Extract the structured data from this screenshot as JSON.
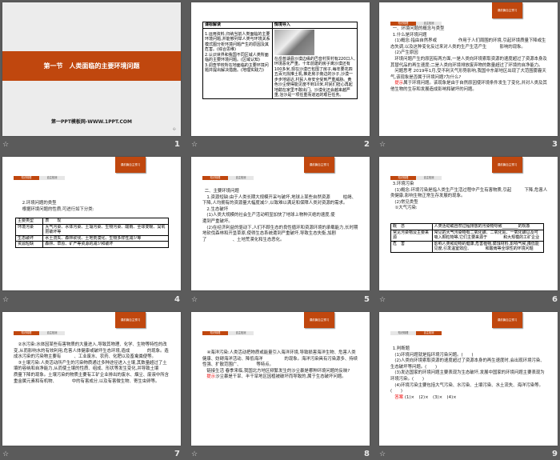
{
  "common": {
    "header_badge": "课前篇自主预习",
    "tab1": "知识梳理",
    "tab2": "自主检测",
    "star_icon": "☆"
  },
  "slides": [
    {
      "number": "1",
      "title": "第一节　人类面临的主要环境问题",
      "footer": "第一PPT模板网-WWW.1PPT.COM"
    },
    {
      "number": "2",
      "table_headers": [
        "课标解读",
        "情境导入"
      ],
      "left": [
        "1.运用资料,归纳当前人类面临的主要环境问题,并能够列举人类与环境关系模式图分析环境问题产生的原因及其危害。(综合思维)",
        "2.认识世界和我国不同区域人类所面临的主要环境问题。(区域认知)",
        "3.调查学校所在地面临的主要环境问题并提出解决措施。(地理实践力)"
      ],
      "right": "在岳普湖县沙漠边缘的巴音村贾村有220口人,环境恶化严重。十年前建的房子离沙漠还有100多米,现在沙漠已包围了房子,每年要花四五百元找推土机,推走房子旁边的沙子,沙漠一步步地逼近,村民人身安全受到严重威胁。黄色沙尘使得能见度不到10米,村民们担心再起地鹬在家里不敢出门。沙漠化还会越来越严重,治沙是一项任重而道远的艰巨任务。"
    },
    {
      "number": "3",
      "lines": [
        "一、环境问题的概念与类型",
        "1.什么是环境问题",
        "(1)概念:指由自然界或　　　　　作用于人们周围的环境,引起环境质量下降或生态失调,以及这种变化反过来对人类的生产生活产生　　　影响的现象。",
        "(2)产生原因",
        "环境问题产生的原因有两方面,一是人类向环境索取资源的速度超过了资源本身及其替代品的再生速度;二是人类向环境排放废弃物的数量超过了环境的自净能力。",
        "问题思考 2019年1月,受不利天气形势影响,我国中东部地区出现了大范围雾霾天气,该现象是否属于环境问题?为什么?"
      ],
      "hint_label": "提示",
      "hint": "属于环境问题。该现象是由于自然原因使环境条件发生了变化,并对人类及其他生物的生存和发展造成影响和破坏的问题。"
    },
    {
      "number": "4",
      "lines": [
        "2.环境问题的类型",
        "根据环境问题的性质,可进行如下分类:"
      ],
      "table": [
        [
          "主要类型",
          "表　　现"
        ],
        [
          "环境污染",
          "大气污染、水体污染、土壤污染、生物污染、酸雨、全球变暖、臭氧层破坏等"
        ],
        [
          "生态破坏",
          "水土流失、森林砍伐、土地荒漠化、生物多样性减少等"
        ],
        [
          "资源短缺",
          "森林、草原、矿产等资源的减少和破坏"
        ]
      ]
    },
    {
      "number": "5",
      "lines": [
        "二、主要环境问题",
        "1.资源短缺:由于人类长期大规模开采与破坏,地球上某些自然资源　　　枯竭、　　　下降,人均拥有的资源量大幅度减少,以致难以满足和保障人类对资源的需求。",
        "2.生态破坏",
        "(1)人类大规模的社会生产活动明显加快了地球上物种灭绝的速度,使　　　　　　遭到严重破坏。",
        "(2)在经济利益的驱动下,人们不顾生态的良性循环和资源环境的承载能力,长时期地砍伐森林和开垦草原,使得生态系统遭到严重破坏,导致生态失衡,加剧了　　　　　　、土地荒漠化和生态恶化。"
      ]
    },
    {
      "number": "6",
      "lines": [
        "3.环境污染",
        "(1)概念:环境污染是指人类生产生活过程中产生有害物质,引起　　　下降,危害人类健康,影响生物正常生存发展的现象。",
        "(2)常见类型",
        "①大气污染:"
      ],
      "table": [
        [
          "概　念",
          "人类活动或自然过程排放的污染物导致________的现象"
        ],
        [
          "常见污染物及主要来源",
          "常见的大气污染物有二氧化碳、二氧化氮、一氧化碳以及可吸入颗粒物等,它们主要来源于　　　　和大规模的工矿企业"
        ],
        [
          "危　害",
          "影响人类和动物的健康,危害植物,腐蚀材料,影响气候,降低能见度,引发温室效应、　　　　和酸雨等全球性的环境问题"
        ]
      ]
    },
    {
      "number": "7",
      "lines": [
        "②水污染:水体因某些有害物质的大量进入,导致其物理、化学、生物等特性的改变,从而影响水的有效利用,危害人体健康或破坏生态环境,造成　　　　的现象。造成水污染的污染物主要有　　　、工业废水、农药、化肥以及畜禽粪便等。",
        "③土壤污染:人类活动所产生的污染物质通过多种途径进入土壤,其数量超过了土壤的容纳和自净能力,从而使土壤的性质、组成、形状等发生变化,并导致土壤　　　　质量下降的现象。土壤污染的物质主要有工矿企业排出的废水、烟尘、废液中所含重金属元素和有机物、　　　　中的有害成分,以及有害微生物、寄生虫卵等。"
      ]
    },
    {
      "number": "8",
      "lines": [
        "④海洋污染:人类活动把物质或能量引入海洋环境,导致损害海洋生物、危害人类健康、妨碍海洋活动、降低海洋　　　　　的现象。海洋污染具有污染源多、持续性强、扩散范围广、　　　　等特点。",
        "链接生活 春季来临,我国北方地区频繁发生的沙尘暴是哪种环境问题的反映?"
      ],
      "hint_label": "提示",
      "hint": "沙尘暴是干旱、半干旱地区因植被破坏而导致的,属于生态破坏问题。"
    },
    {
      "number": "9",
      "lines": [
        "1.判断题",
        "(1)环境问题就是指环境污染问题。(　　)",
        "(2)人类向环境索取资源的速度超过了资源本身的再生速度时,会出现环境污染、生态破坏等问题。(　　)",
        "(3)发达国家的环境问题主要表现为生态破坏,发展中国家的环境问题主要表现为环境污染。(　　)",
        "(4)环境污染主要包括大气污染、水污染、土壤污染、水土流失、海洋污染等。(　　)"
      ],
      "answer_label": "答案",
      "answer": "(1)×　(2)×　(3)×　(4)×"
    }
  ]
}
